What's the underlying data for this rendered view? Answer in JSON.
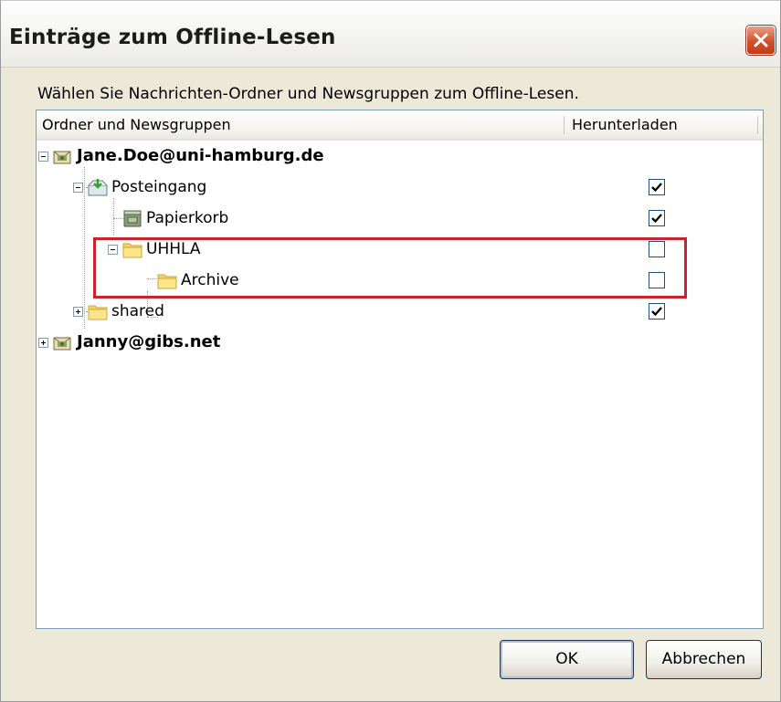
{
  "window": {
    "title": "Einträge zum Offline-Lesen",
    "close_icon": "close-icon"
  },
  "description": "Wählen Sie Nachrichten-Ordner und Newsgruppen zum Offline-Lesen.",
  "columns": {
    "name": "Ordner und Newsgruppen",
    "download": "Herunterladen"
  },
  "tree": [
    {
      "label": "Jane.Doe@uni-hamburg.de",
      "level": 0,
      "expander": "collapse",
      "icon": "mail-account-icon",
      "bold": true,
      "checked": null
    },
    {
      "label": "Posteingang",
      "level": 1,
      "expander": "collapse",
      "icon": "inbox-icon",
      "bold": false,
      "checked": true
    },
    {
      "label": "Papierkorb",
      "level": 2,
      "expander": null,
      "icon": "trash-icon",
      "bold": false,
      "checked": true
    },
    {
      "label": "UHHLA",
      "level": 2,
      "expander": "collapse",
      "icon": "folder-icon",
      "bold": false,
      "checked": false
    },
    {
      "label": "Archive",
      "level": 3,
      "expander": null,
      "icon": "folder-icon",
      "bold": false,
      "checked": false
    },
    {
      "label": "shared",
      "level": 1,
      "expander": "expand",
      "icon": "folder-icon",
      "bold": false,
      "checked": true
    },
    {
      "label": "Janny@gibs.net",
      "level": 0,
      "expander": "expand",
      "icon": "mail-account-icon",
      "bold": true,
      "checked": null
    }
  ],
  "buttons": {
    "ok": "OK",
    "cancel": "Abbrechen"
  },
  "colors": {
    "highlight": "#c8252b",
    "folder": "#f7d55b",
    "titlebar_close": "#d0522c"
  }
}
